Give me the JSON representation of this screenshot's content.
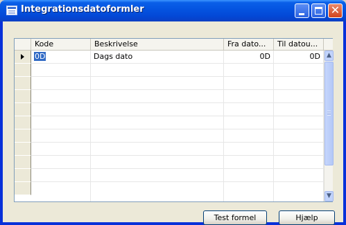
{
  "window": {
    "title": "Integrationsdatoformler",
    "icons": [
      "form-icon",
      "minimize-icon",
      "maximize-icon",
      "close-icon"
    ]
  },
  "table": {
    "columns": [
      "Kode",
      "Beskrivelse",
      "Fra dato...",
      "Til datou..."
    ],
    "rows": [
      {
        "kode": "0D",
        "beskrivelse": "Dags dato",
        "fra": "0D",
        "til": "0D"
      }
    ],
    "selected_cell": "0D"
  },
  "buttons": {
    "test_formel": "Test formel",
    "hjaelp": "Hjælp"
  },
  "colors": {
    "titlebar": "#0453e0",
    "selection": "#316ac5",
    "close_button": "#d2431d"
  }
}
